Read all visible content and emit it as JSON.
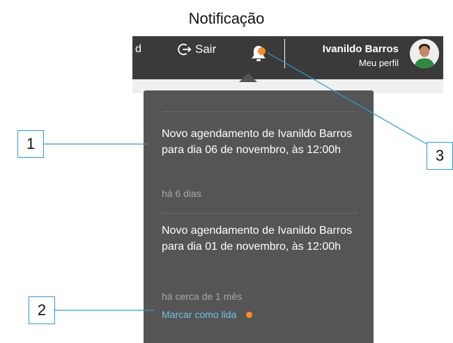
{
  "page": {
    "title": "Notificação"
  },
  "navbar": {
    "cut_text": "d",
    "logout_label": "Sair",
    "user_name": "Ivanildo Barros",
    "profile_label": "Meu perfil"
  },
  "notifications": [
    {
      "text": "Novo agendamento de Ivanildo Barros para dia 06 de novembro, às 12:00h",
      "time": "há 6 dias"
    },
    {
      "text": "Novo agendamento de Ivanildo Barros para dia 01 de novembro, às 12:00h",
      "time": "há cerca de 1 mês"
    }
  ],
  "mark_read_label": "Marcar como lida",
  "callouts": [
    "1",
    "2",
    "3"
  ],
  "colors": {
    "unread_dot": "#ff8a1f",
    "link": "#6ec3ea",
    "callout": "#2a9fd6",
    "panel": "#555555",
    "navbar": "#3a3a3a"
  },
  "icons": [
    "logout-icon",
    "bell-icon"
  ]
}
